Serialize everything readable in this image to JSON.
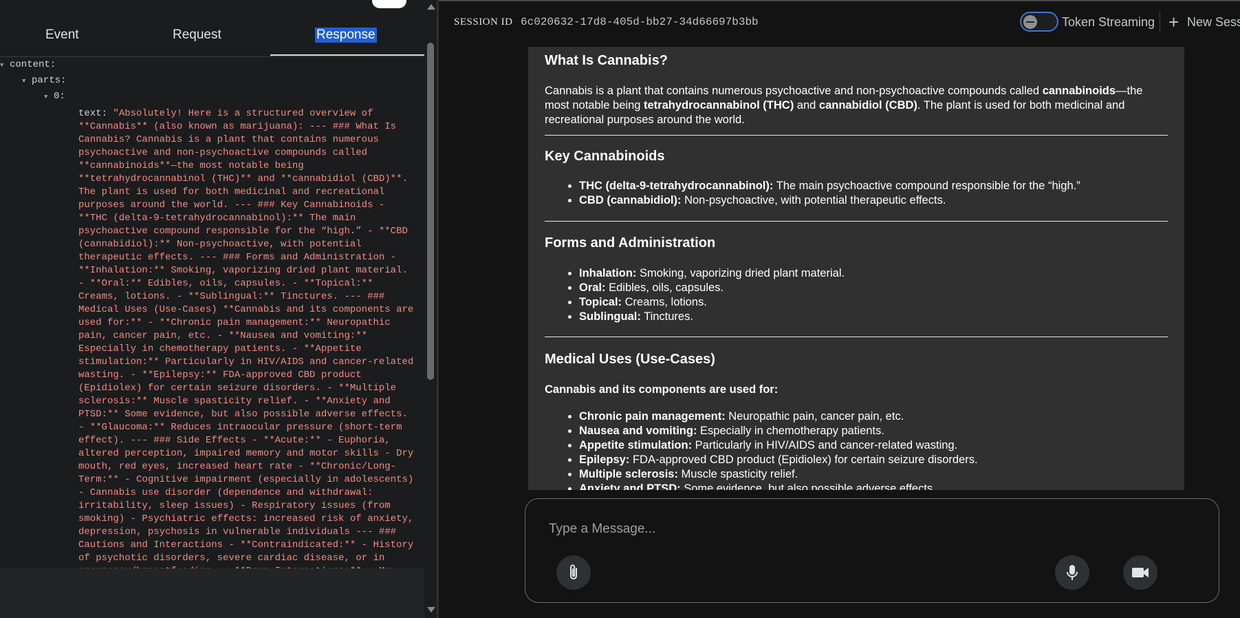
{
  "left_panel": {
    "tabs": [
      {
        "label": "Event"
      },
      {
        "label": "Request"
      },
      {
        "label": "Response"
      }
    ],
    "tree": {
      "content_key": "content:",
      "parts_key": "parts:",
      "index_key": "0:",
      "text_key": "text:",
      "text_value": "\"Absolutely! Here is a structured overview of **Cannabis** (also known as marijuana): --- ### What Is Cannabis? Cannabis is a plant that contains numerous psychoactive and non-psychoactive compounds called **cannabinoids**—the most notable being **tetrahydrocannabinol (THC)** and **cannabidiol (CBD)**. The plant is used for both medicinal and recreational purposes around the world. --- ### Key Cannabinoids - **THC (delta-9-tetrahydrocannabinol):** The main psychoactive compound responsible for the “high.” - **CBD (cannabidiol):** Non-psychoactive, with potential therapeutic effects. --- ### Forms and Administration - **Inhalation:** Smoking, vaporizing dried plant material. - **Oral:** Edibles, oils, capsules. - **Topical:** Creams, lotions. - **Sublingual:** Tinctures. --- ### Medical Uses (Use-Cases) **Cannabis and its components are used for:** - **Chronic pain management:** Neuropathic pain, cancer pain, etc. - **Nausea and vomiting:** Especially in chemotherapy patients. - **Appetite stimulation:** Particularly in HIV/AIDS and cancer-related wasting. - **Epilepsy:** FDA-approved CBD product (Epidiolex) for certain seizure disorders. - **Multiple sclerosis:** Muscle spasticity relief. - **Anxiety and PTSD:** Some evidence, but also possible adverse effects. - **Glaucoma:** Reduces intraocular pressure (short-term effect). --- ### Side Effects - **Acute:** - Euphoria, altered perception, impaired memory and motor skills - Dry mouth, red eyes, increased heart rate - **Chronic/Long-Term:** - Cognitive impairment (especially in adolescents) - Cannabis use disorder (dependence and withdrawal: irritability, sleep issues) - Respiratory issues (from smoking) - Psychiatric effects: increased risk of anxiety, depression, psychosis in vulnerable individuals --- ### Cautions and Interactions - **Contraindicated:** - History of psychotic disorders, severe cardiac disease, or in pregnancy/breastfeeding. - **Drug Interactions:** - May interact with CNS depressants,"
    }
  },
  "header": {
    "session_label": "SESSION ID",
    "session_id": "6c020632-17d8-405d-bb27-34d66697b3bb",
    "toggle_label": "Token Streaming",
    "new_session_label": "New Session"
  },
  "message": {
    "h_what": "What Is Cannabis?",
    "p_what": {
      "t1": "Cannabis is a plant that contains numerous psychoactive and non-psychoactive compounds called ",
      "b1": "cannabinoids",
      "t2": "—the most notable being ",
      "b2": "tetrahydrocannabinol (THC)",
      "t3": " and ",
      "b3": "cannabidiol (CBD)",
      "t4": ". The plant is used for both medicinal and recreational purposes around the world."
    },
    "h_key": "Key Cannabinoids",
    "key_items": [
      {
        "b": "THC (delta-9-tetrahydrocannabinol):",
        "t": " The main psychoactive compound responsible for the “high.”"
      },
      {
        "b": "CBD (cannabidiol):",
        "t": " Non-psychoactive, with potential therapeutic effects."
      }
    ],
    "h_forms": "Forms and Administration",
    "forms_items": [
      {
        "b": "Inhalation:",
        "t": " Smoking, vaporizing dried plant material."
      },
      {
        "b": "Oral:",
        "t": " Edibles, oils, capsules."
      },
      {
        "b": "Topical:",
        "t": " Creams, lotions."
      },
      {
        "b": "Sublingual:",
        "t": " Tinctures."
      }
    ],
    "h_medical": "Medical Uses (Use-Cases)",
    "medical_intro": "Cannabis and its components are used for:",
    "medical_items": [
      {
        "b": "Chronic pain management:",
        "t": " Neuropathic pain, cancer pain, etc."
      },
      {
        "b": "Nausea and vomiting:",
        "t": " Especially in chemotherapy patients."
      },
      {
        "b": "Appetite stimulation:",
        "t": " Particularly in HIV/AIDS and cancer-related wasting."
      },
      {
        "b": "Epilepsy:",
        "t": " FDA-approved CBD product (Epidiolex) for certain seizure disorders."
      },
      {
        "b": "Multiple sclerosis:",
        "t": " Muscle spasticity relief."
      },
      {
        "b": "Anxiety and PTSD:",
        "t": " Some evidence, but also possible adverse effects."
      }
    ]
  },
  "composer": {
    "placeholder": "Type a Message..."
  },
  "icons": {
    "attach": "paperclip-icon",
    "mic": "microphone-icon",
    "video": "video-camera-icon",
    "plus": "plus-icon"
  },
  "colors": {
    "accent": "#1f5fd1",
    "json_string": "#f28b82",
    "toggle_border": "#3f73d6"
  }
}
